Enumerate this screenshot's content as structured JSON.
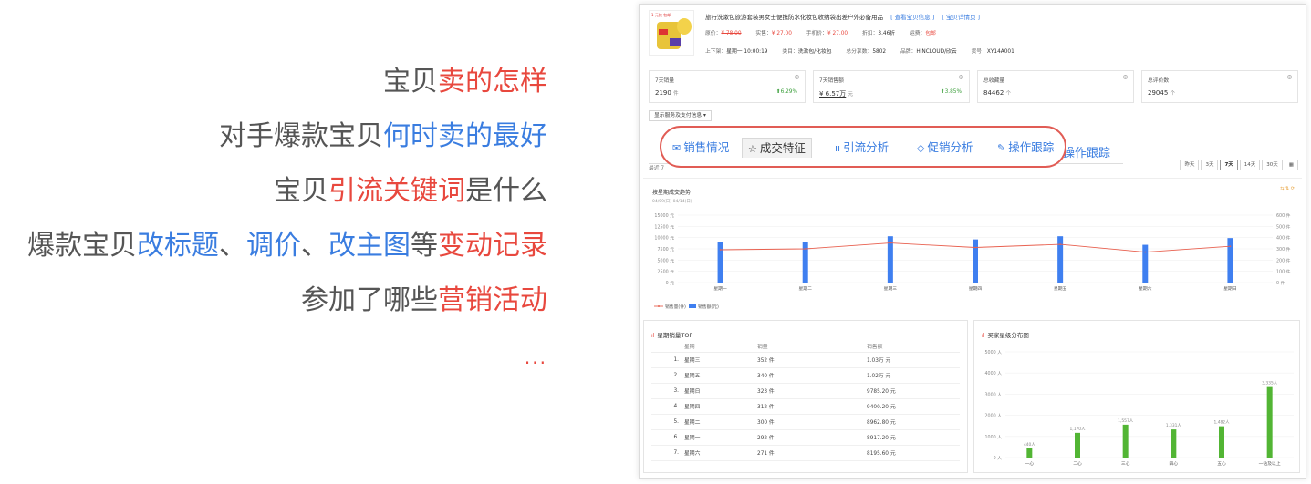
{
  "left": {
    "lines": [
      [
        {
          "t": "宝贝",
          "c": "gray"
        },
        {
          "t": "卖的怎样",
          "c": "red"
        }
      ],
      [
        {
          "t": "对手爆款宝贝",
          "c": "gray"
        },
        {
          "t": "何时卖的最好",
          "c": "blue"
        }
      ],
      [
        {
          "t": "宝贝",
          "c": "gray"
        },
        {
          "t": "引流关键词",
          "c": "red"
        },
        {
          "t": "是什么",
          "c": "gray"
        }
      ],
      [
        {
          "t": "爆款宝贝",
          "c": "gray"
        },
        {
          "t": "改标题",
          "c": "blue"
        },
        {
          "t": "、",
          "c": "gray"
        },
        {
          "t": "调价",
          "c": "blue"
        },
        {
          "t": "、",
          "c": "gray"
        },
        {
          "t": "改主图",
          "c": "blue"
        },
        {
          "t": "等",
          "c": "gray"
        },
        {
          "t": "变动记录",
          "c": "red"
        }
      ],
      [
        {
          "t": "参加了哪些",
          "c": "gray"
        },
        {
          "t": "营销活动",
          "c": "red"
        }
      ]
    ],
    "ellipsis": "..."
  },
  "product": {
    "thumb_tag": "1 元抢 包邮",
    "title": "旅行洗漱包旅游套装男女士便携防水化妆包收纳袋出差户外必备用品",
    "link1": "[ 查看宝贝信息 ]",
    "link2": "[ 宝贝详情页 ]",
    "row1": {
      "orig_label": "原价：",
      "orig_value": "¥ 78.00",
      "real_label": "实售：",
      "real_value": "¥ 27.00",
      "mobile_label": "手机价：",
      "mobile_value": "¥ 27.00",
      "discount_label": "折扣：",
      "discount_value": "3.46折",
      "ship_label": "运费：",
      "ship_value": "包邮"
    },
    "row2": {
      "list_label": "上下架：",
      "list_value": "星期一 10:00:19",
      "cat_label": "类目：",
      "cat_value": "洗漱包/化妆包",
      "sold_label": "总分享数：",
      "sold_value": "5802",
      "brand_label": "品牌：",
      "brand_value": "HINCLOUD/欣云",
      "sku_label": "货号：",
      "sku_value": "XY14A001"
    }
  },
  "stats": [
    {
      "title": "7天销量",
      "value": "2190",
      "unit": "件",
      "change": "⬆6.29%"
    },
    {
      "title": "7天销售额",
      "value": "¥ 6.57万",
      "unit": "元",
      "change": "⬆3.85%"
    },
    {
      "title": "总收藏量",
      "value": "84462",
      "unit": "个",
      "change": ""
    },
    {
      "title": "总评价数",
      "value": "29045",
      "unit": "个",
      "change": ""
    }
  ],
  "service_dropdown": "显示服务及支付信息 ▾",
  "faded_tabs": [
    "销售情况",
    "成交特征",
    "引流分析",
    "促销分析",
    "操作跟踪",
    "操作跟踪"
  ],
  "tabs": [
    {
      "icon": "✉",
      "label": "销售情况"
    },
    {
      "icon": "☆",
      "label": "成交特征"
    },
    {
      "icon": "ıı",
      "label": "引流分析"
    },
    {
      "icon": "◇",
      "label": "促销分析"
    },
    {
      "icon": "✎",
      "label": "操作跟踪"
    }
  ],
  "recent_label": "最近 7",
  "ranges": [
    "昨天",
    "3天",
    "7天",
    "14天",
    "30天",
    "▦"
  ],
  "main_chart_meta": {
    "title": "按星期成交趋势",
    "subtitle": "04/09(日)-04/14(日)",
    "tools": "⇆ ⇅ ⟳"
  },
  "chart_data": [
    {
      "type": "bar",
      "title": "按星期成交趋势",
      "categories": [
        "星期一",
        "星期二",
        "星期三",
        "星期四",
        "星期五",
        "星期六",
        "星期日"
      ],
      "series": [
        {
          "name": "销售额(元)",
          "kind": "bar",
          "axis": "left",
          "values": [
            9100,
            9100,
            10300,
            9600,
            10300,
            8400,
            9900
          ]
        },
        {
          "name": "销售量(件)",
          "kind": "line",
          "axis": "right",
          "values": [
            292,
            300,
            352,
            312,
            340,
            271,
            323
          ]
        }
      ],
      "left_ticks": [
        "0 元",
        "2500 元",
        "5000 元",
        "7500 元",
        "10000 元",
        "12500 元",
        "15000 元"
      ],
      "right_ticks": [
        "0 件",
        "100 件",
        "200 件",
        "300 件",
        "400 件",
        "500 件",
        "600 件"
      ],
      "ylim_left": [
        0,
        15000
      ],
      "ylim_right": [
        0,
        600
      ],
      "legend": "bottom-left",
      "colors": {
        "bar": "#3f7ff0",
        "line": "#e8604f"
      }
    },
    {
      "type": "bar",
      "title": "买家星级分布图",
      "categories": [
        "一心",
        "二心",
        "三心",
        "四心",
        "五心",
        "一钻及以上"
      ],
      "values": [
        440,
        1170,
        1557,
        1331,
        1482,
        3335
      ],
      "data_labels": [
        "440人",
        "1,170人",
        "1,557人",
        "1,331人",
        "1,482人",
        "3,335人"
      ],
      "y_ticks": [
        "0 人",
        "1000 人",
        "2000 人",
        "3000 人",
        "4000 人",
        "5000 人"
      ],
      "ylim": [
        0,
        5000
      ],
      "colors": {
        "bar": "#52b534"
      }
    }
  ],
  "top_table": {
    "title": "星期销量TOP",
    "headers": [
      "",
      "星期",
      "销量",
      "销售额"
    ],
    "rows": [
      [
        "1.",
        "星期三",
        "352 件",
        "1.03万 元"
      ],
      [
        "2.",
        "星期五",
        "340 件",
        "1.02万 元"
      ],
      [
        "3.",
        "星期日",
        "323 件",
        "9785.20 元"
      ],
      [
        "4.",
        "星期四",
        "312 件",
        "9400.20 元"
      ],
      [
        "5.",
        "星期二",
        "300 件",
        "8962.80 元"
      ],
      [
        "6.",
        "星期一",
        "292 件",
        "8917.20 元"
      ],
      [
        "7.",
        "星期六",
        "271 件",
        "8195.60 元"
      ]
    ]
  },
  "dist_title": "买家星级分布图"
}
